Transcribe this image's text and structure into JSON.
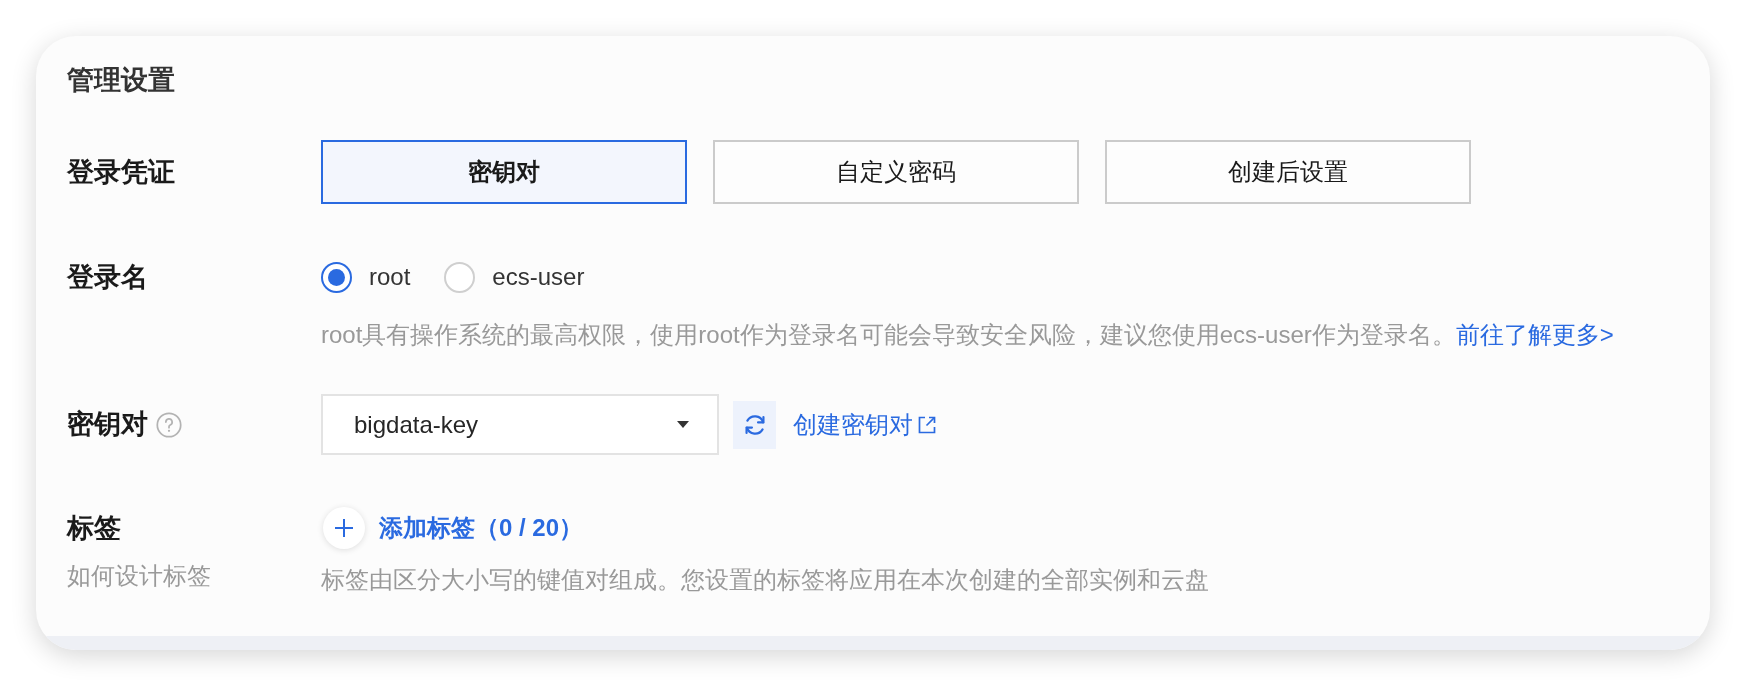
{
  "section": {
    "title": "管理设置"
  },
  "login_credential": {
    "label": "登录凭证",
    "options": [
      {
        "label": "密钥对",
        "selected": true
      },
      {
        "label": "自定义密码",
        "selected": false
      },
      {
        "label": "创建后设置",
        "selected": false
      }
    ]
  },
  "login_name": {
    "label": "登录名",
    "options": [
      {
        "label": "root",
        "selected": true
      },
      {
        "label": "ecs-user",
        "selected": false
      }
    ],
    "hint": "root具有操作系统的最高权限，使用root作为登录名可能会导致安全风险，建议您使用ecs-user作为登录名。",
    "link": "前往了解更多>"
  },
  "key_pair": {
    "label": "密钥对",
    "select": {
      "value": "bigdata-key"
    },
    "create_link": "创建密钥对"
  },
  "tags": {
    "label": "标签",
    "guide_link": "如何设计标签",
    "add_button": "添加标签（0 / 20）",
    "hint": "标签由区分大小写的键值对组成。您设置的标签将应用在本次创建的全部实例和云盘"
  }
}
